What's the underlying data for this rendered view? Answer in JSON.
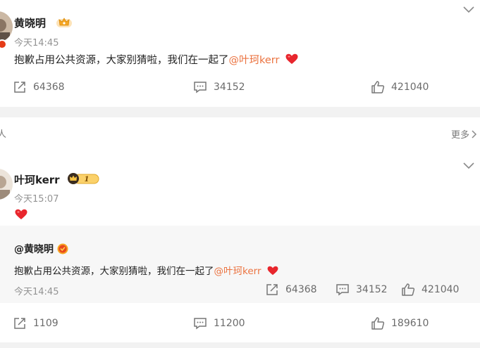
{
  "post1": {
    "author": "黄晓明",
    "time": "今天14:45",
    "text": "抱歉占用公共资源，大家别猜啦，我们在一起了",
    "mention": "@叶珂kerr",
    "stats": {
      "repost": "64368",
      "comment": "34152",
      "like": "421040"
    }
  },
  "divider": {
    "left_char": "人",
    "more_label": "更多"
  },
  "post2": {
    "author": "叶珂kerr",
    "badge_level": "1",
    "time": "今天15:07",
    "quoted": {
      "author": "@黄晓明",
      "text": "抱歉占用公共资源，大家别猜啦，我们在一起了",
      "mention": "@叶珂kerr",
      "time": "今天14:45",
      "stats": {
        "repost": "64368",
        "comment": "34152",
        "like": "421040"
      }
    },
    "stats": {
      "repost": "1109",
      "comment": "11200",
      "like": "189610"
    }
  },
  "colors": {
    "mention": "#eb7340",
    "heart": "#e8262d",
    "verified": "#e53b17",
    "crown": "#f5a623"
  }
}
